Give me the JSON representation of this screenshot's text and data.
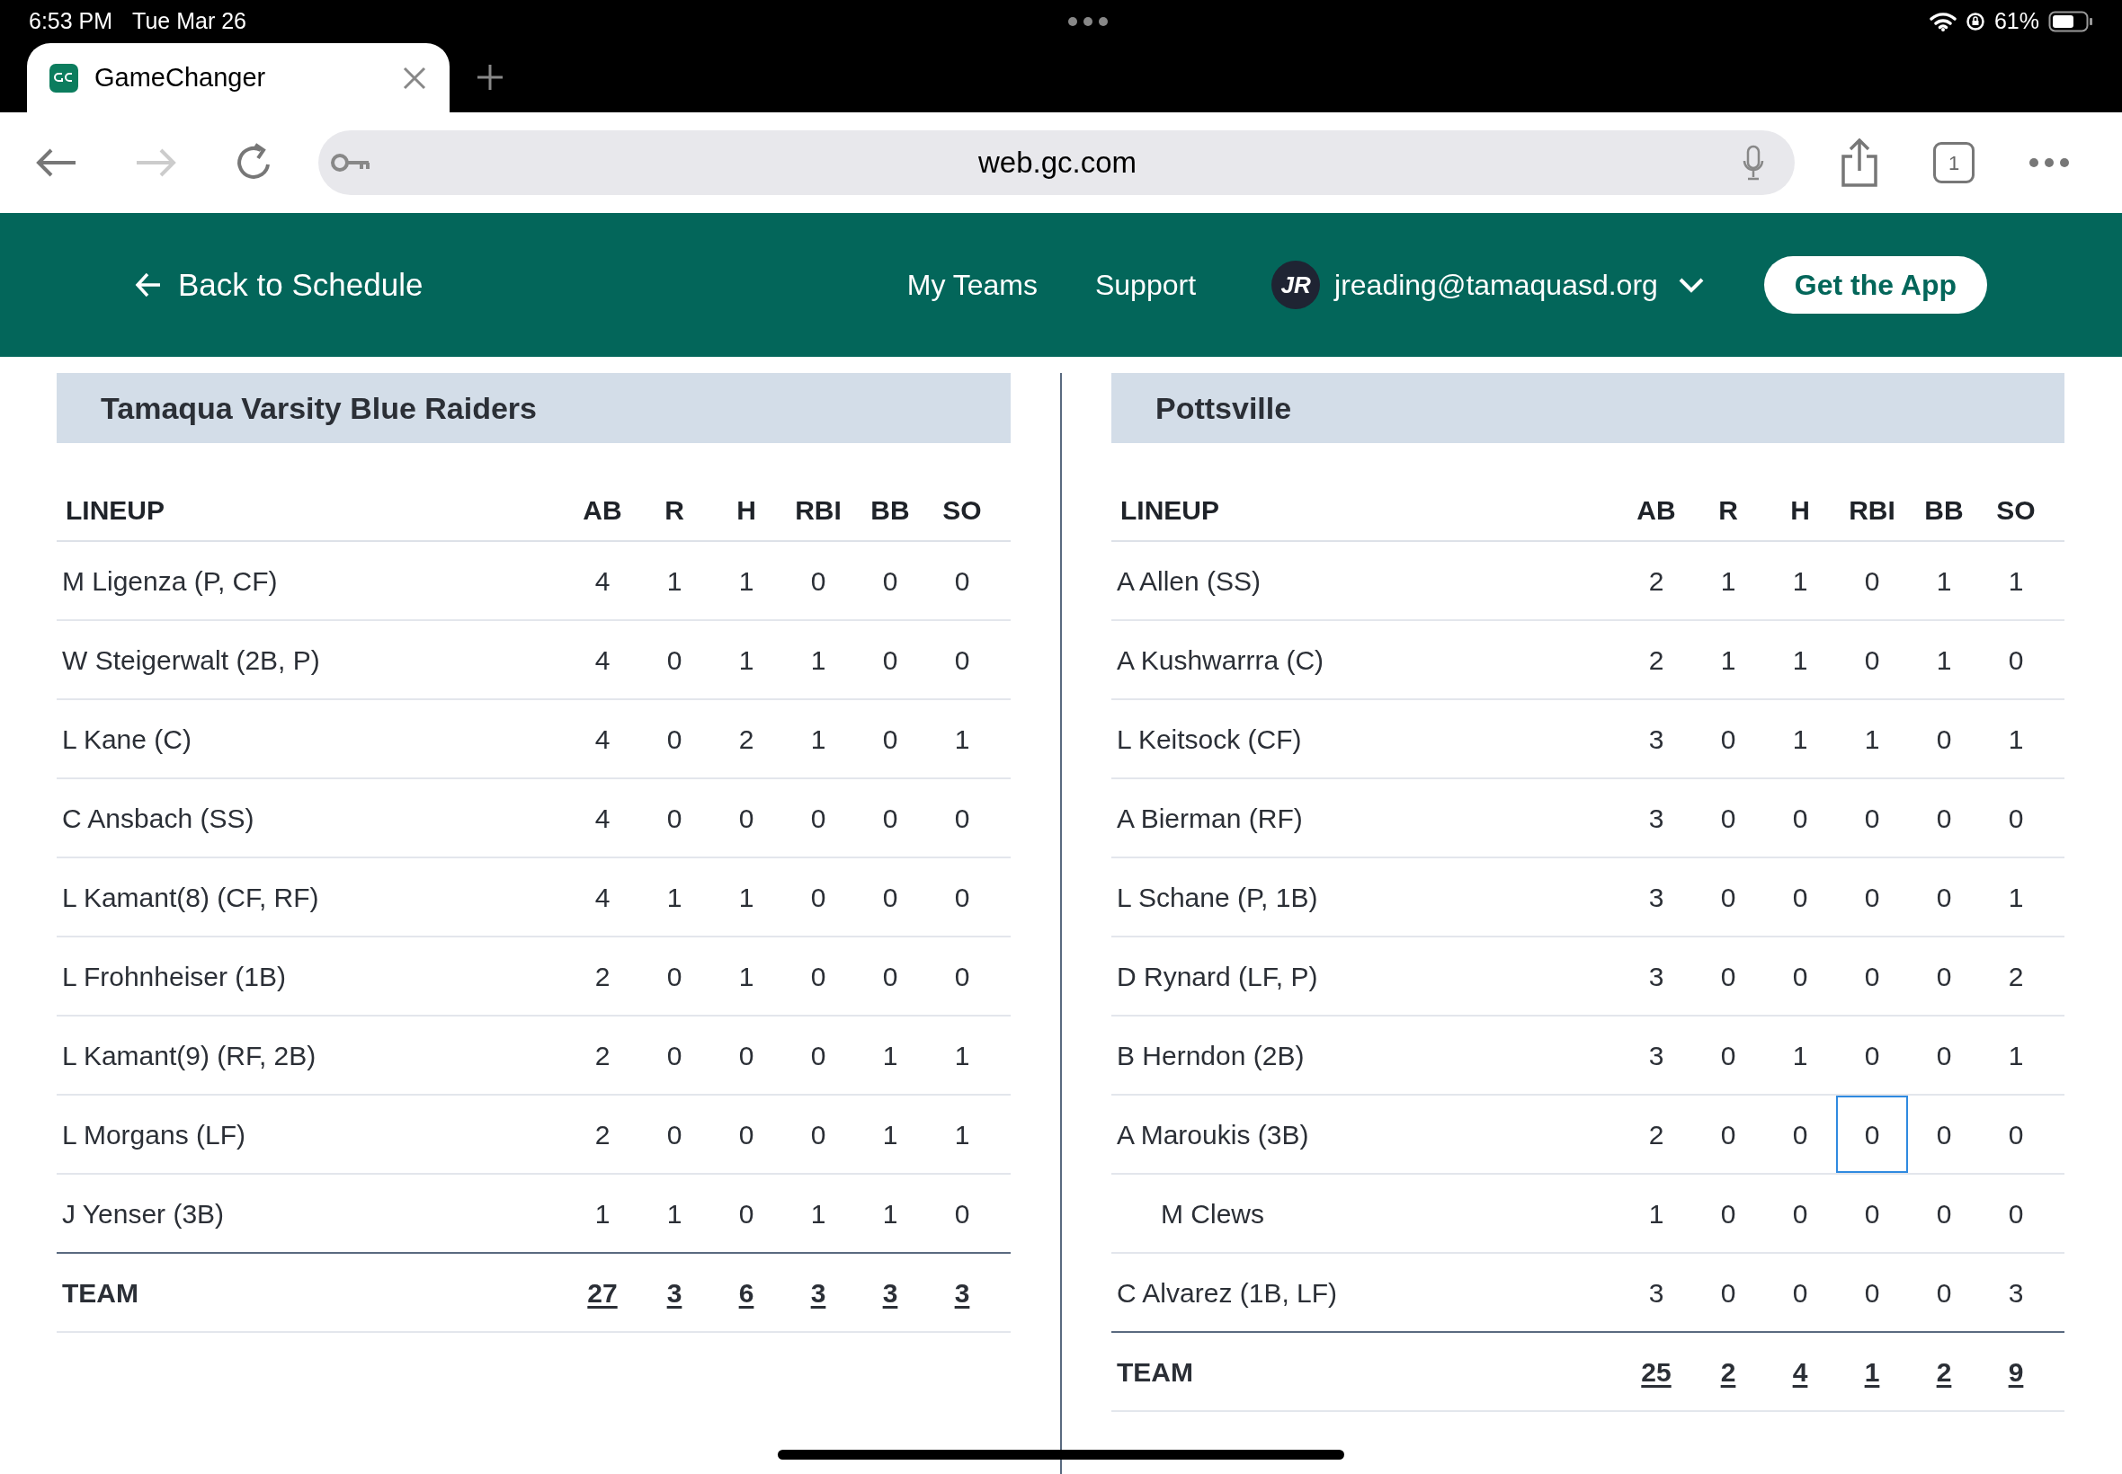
{
  "status_bar": {
    "time": "6:53 PM",
    "date": "Tue Mar 26",
    "battery_text": "61%"
  },
  "browser": {
    "tab": {
      "title": "GameChanger"
    },
    "url": "web.gc.com",
    "tab_count": "1",
    "forward_disabled": true
  },
  "header": {
    "back_link": "Back to Schedule",
    "nav": [
      "My Teams",
      "Support"
    ],
    "avatar_initials": "JR",
    "user_email": "jreading@tamaquasd.org",
    "cta": "Get the App"
  },
  "teams": [
    {
      "name": "Tamaqua Varsity Blue Raiders",
      "columns": [
        "LINEUP",
        "AB",
        "R",
        "H",
        "RBI",
        "BB",
        "SO"
      ],
      "rows": [
        {
          "player": "M Ligenza (P, CF)",
          "substitute": false,
          "stats": [
            {
              "value": "4",
              "focused": false
            },
            {
              "value": "1",
              "focused": false
            },
            {
              "value": "1",
              "focused": false
            },
            {
              "value": "0",
              "focused": false
            },
            {
              "value": "0",
              "focused": false
            },
            {
              "value": "0",
              "focused": false
            }
          ]
        },
        {
          "player": "W Steigerwalt (2B, P)",
          "substitute": false,
          "stats": [
            {
              "value": "4",
              "focused": false
            },
            {
              "value": "0",
              "focused": false
            },
            {
              "value": "1",
              "focused": false
            },
            {
              "value": "1",
              "focused": false
            },
            {
              "value": "0",
              "focused": false
            },
            {
              "value": "0",
              "focused": false
            }
          ]
        },
        {
          "player": "L Kane (C)",
          "substitute": false,
          "stats": [
            {
              "value": "4",
              "focused": false
            },
            {
              "value": "0",
              "focused": false
            },
            {
              "value": "2",
              "focused": false
            },
            {
              "value": "1",
              "focused": false
            },
            {
              "value": "0",
              "focused": false
            },
            {
              "value": "1",
              "focused": false
            }
          ]
        },
        {
          "player": "C Ansbach (SS)",
          "substitute": false,
          "stats": [
            {
              "value": "4",
              "focused": false
            },
            {
              "value": "0",
              "focused": false
            },
            {
              "value": "0",
              "focused": false
            },
            {
              "value": "0",
              "focused": false
            },
            {
              "value": "0",
              "focused": false
            },
            {
              "value": "0",
              "focused": false
            }
          ]
        },
        {
          "player": "L Kamant(8) (CF, RF)",
          "substitute": false,
          "stats": [
            {
              "value": "4",
              "focused": false
            },
            {
              "value": "1",
              "focused": false
            },
            {
              "value": "1",
              "focused": false
            },
            {
              "value": "0",
              "focused": false
            },
            {
              "value": "0",
              "focused": false
            },
            {
              "value": "0",
              "focused": false
            }
          ]
        },
        {
          "player": "L Frohnheiser (1B)",
          "substitute": false,
          "stats": [
            {
              "value": "2",
              "focused": false
            },
            {
              "value": "0",
              "focused": false
            },
            {
              "value": "1",
              "focused": false
            },
            {
              "value": "0",
              "focused": false
            },
            {
              "value": "0",
              "focused": false
            },
            {
              "value": "0",
              "focused": false
            }
          ]
        },
        {
          "player": "L Kamant(9) (RF, 2B)",
          "substitute": false,
          "stats": [
            {
              "value": "2",
              "focused": false
            },
            {
              "value": "0",
              "focused": false
            },
            {
              "value": "0",
              "focused": false
            },
            {
              "value": "0",
              "focused": false
            },
            {
              "value": "1",
              "focused": false
            },
            {
              "value": "1",
              "focused": false
            }
          ]
        },
        {
          "player": "L Morgans (LF)",
          "substitute": false,
          "stats": [
            {
              "value": "2",
              "focused": false
            },
            {
              "value": "0",
              "focused": false
            },
            {
              "value": "0",
              "focused": false
            },
            {
              "value": "0",
              "focused": false
            },
            {
              "value": "1",
              "focused": false
            },
            {
              "value": "1",
              "focused": false
            }
          ]
        },
        {
          "player": "J Yenser (3B)",
          "substitute": false,
          "stats": [
            {
              "value": "1",
              "focused": false
            },
            {
              "value": "1",
              "focused": false
            },
            {
              "value": "0",
              "focused": false
            },
            {
              "value": "1",
              "focused": false
            },
            {
              "value": "1",
              "focused": false
            },
            {
              "value": "0",
              "focused": false
            }
          ]
        }
      ],
      "totals": {
        "label": "TEAM",
        "values": [
          "27",
          "3",
          "6",
          "3",
          "3",
          "3"
        ]
      }
    },
    {
      "name": "Pottsville",
      "columns": [
        "LINEUP",
        "AB",
        "R",
        "H",
        "RBI",
        "BB",
        "SO"
      ],
      "rows": [
        {
          "player": "A Allen (SS)",
          "substitute": false,
          "stats": [
            {
              "value": "2",
              "focused": false
            },
            {
              "value": "1",
              "focused": false
            },
            {
              "value": "1",
              "focused": false
            },
            {
              "value": "0",
              "focused": false
            },
            {
              "value": "1",
              "focused": false
            },
            {
              "value": "1",
              "focused": false
            }
          ]
        },
        {
          "player": "A Kushwarrra (C)",
          "substitute": false,
          "stats": [
            {
              "value": "2",
              "focused": false
            },
            {
              "value": "1",
              "focused": false
            },
            {
              "value": "1",
              "focused": false
            },
            {
              "value": "0",
              "focused": false
            },
            {
              "value": "1",
              "focused": false
            },
            {
              "value": "0",
              "focused": false
            }
          ]
        },
        {
          "player": "L Keitsock (CF)",
          "substitute": false,
          "stats": [
            {
              "value": "3",
              "focused": false
            },
            {
              "value": "0",
              "focused": false
            },
            {
              "value": "1",
              "focused": false
            },
            {
              "value": "1",
              "focused": false
            },
            {
              "value": "0",
              "focused": false
            },
            {
              "value": "1",
              "focused": false
            }
          ]
        },
        {
          "player": "A Bierman (RF)",
          "substitute": false,
          "stats": [
            {
              "value": "3",
              "focused": false
            },
            {
              "value": "0",
              "focused": false
            },
            {
              "value": "0",
              "focused": false
            },
            {
              "value": "0",
              "focused": false
            },
            {
              "value": "0",
              "focused": false
            },
            {
              "value": "0",
              "focused": false
            }
          ]
        },
        {
          "player": "L Schane (P, 1B)",
          "substitute": false,
          "stats": [
            {
              "value": "3",
              "focused": false
            },
            {
              "value": "0",
              "focused": false
            },
            {
              "value": "0",
              "focused": false
            },
            {
              "value": "0",
              "focused": false
            },
            {
              "value": "0",
              "focused": false
            },
            {
              "value": "1",
              "focused": false
            }
          ]
        },
        {
          "player": "D Rynard (LF, P)",
          "substitute": false,
          "stats": [
            {
              "value": "3",
              "focused": false
            },
            {
              "value": "0",
              "focused": false
            },
            {
              "value": "0",
              "focused": false
            },
            {
              "value": "0",
              "focused": false
            },
            {
              "value": "0",
              "focused": false
            },
            {
              "value": "2",
              "focused": false
            }
          ]
        },
        {
          "player": "B Herndon (2B)",
          "substitute": false,
          "stats": [
            {
              "value": "3",
              "focused": false
            },
            {
              "value": "0",
              "focused": false
            },
            {
              "value": "1",
              "focused": false
            },
            {
              "value": "0",
              "focused": false
            },
            {
              "value": "0",
              "focused": false
            },
            {
              "value": "1",
              "focused": false
            }
          ]
        },
        {
          "player": "A Maroukis (3B)",
          "substitute": false,
          "stats": [
            {
              "value": "2",
              "focused": false
            },
            {
              "value": "0",
              "focused": false
            },
            {
              "value": "0",
              "focused": false
            },
            {
              "value": "0",
              "focused": true
            },
            {
              "value": "0",
              "focused": false
            },
            {
              "value": "0",
              "focused": false
            }
          ]
        },
        {
          "player": "M Clews",
          "substitute": true,
          "stats": [
            {
              "value": "1",
              "focused": false
            },
            {
              "value": "0",
              "focused": false
            },
            {
              "value": "0",
              "focused": false
            },
            {
              "value": "0",
              "focused": false
            },
            {
              "value": "0",
              "focused": false
            },
            {
              "value": "0",
              "focused": false
            }
          ]
        },
        {
          "player": "C Alvarez (1B, LF)",
          "substitute": false,
          "stats": [
            {
              "value": "3",
              "focused": false
            },
            {
              "value": "0",
              "focused": false
            },
            {
              "value": "0",
              "focused": false
            },
            {
              "value": "0",
              "focused": false
            },
            {
              "value": "0",
              "focused": false
            },
            {
              "value": "3",
              "focused": false
            }
          ]
        }
      ],
      "totals": {
        "label": "TEAM",
        "values": [
          "25",
          "2",
          "4",
          "1",
          "2",
          "9"
        ]
      }
    }
  ]
}
